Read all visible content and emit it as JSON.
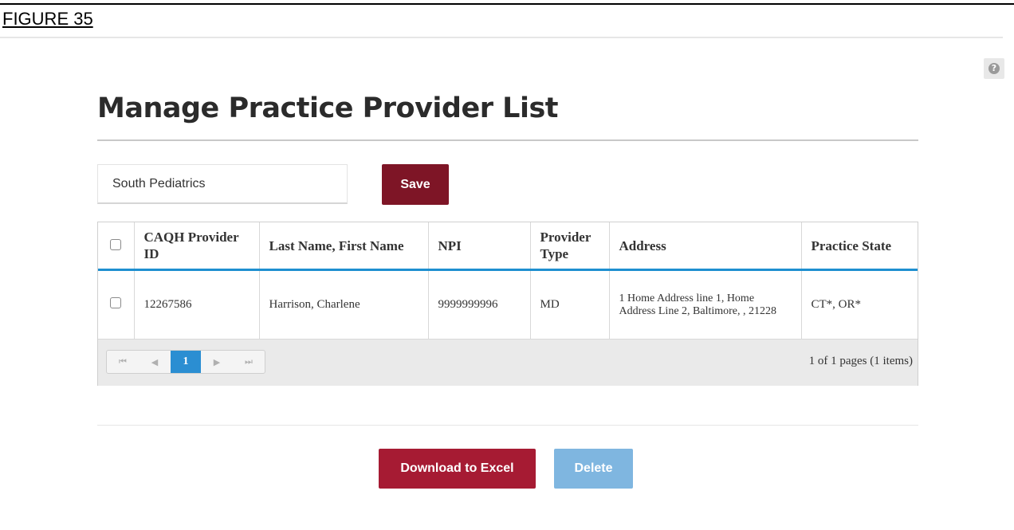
{
  "figure_label": "FIGURE 35",
  "help_icon": {
    "name": "question-circle-icon",
    "glyph": "?"
  },
  "page_title": "Manage Practice Provider List",
  "practice_input": {
    "value": "South Pediatrics"
  },
  "save_label": "Save",
  "table": {
    "columns": [
      "CAQH Provider ID",
      "Last Name, First Name",
      "NPI",
      "Provider Type",
      "Address",
      "Practice State"
    ],
    "rows": [
      {
        "caqh_provider_id": "12267586",
        "name": "Harrison, Charlene",
        "npi": "9999999996",
        "provider_type": "MD",
        "address": "1 Home Address line 1, Home Address Line 2, Baltimore, , 21228",
        "practice_state": "CT*, OR*"
      }
    ]
  },
  "pager": {
    "first_icon": "⏮",
    "prev_icon": "◀",
    "current_page": "1",
    "next_icon": "▶",
    "last_icon": "⏭",
    "info": "1 of 1 pages (1 items)"
  },
  "actions": {
    "download_label": "Download to Excel",
    "delete_label": "Delete"
  },
  "colors": {
    "primary_button": "#a61b33",
    "save_button": "#7e1526",
    "accent_blue": "#2b8ed2",
    "disabled_button": "#7fb6e0"
  }
}
